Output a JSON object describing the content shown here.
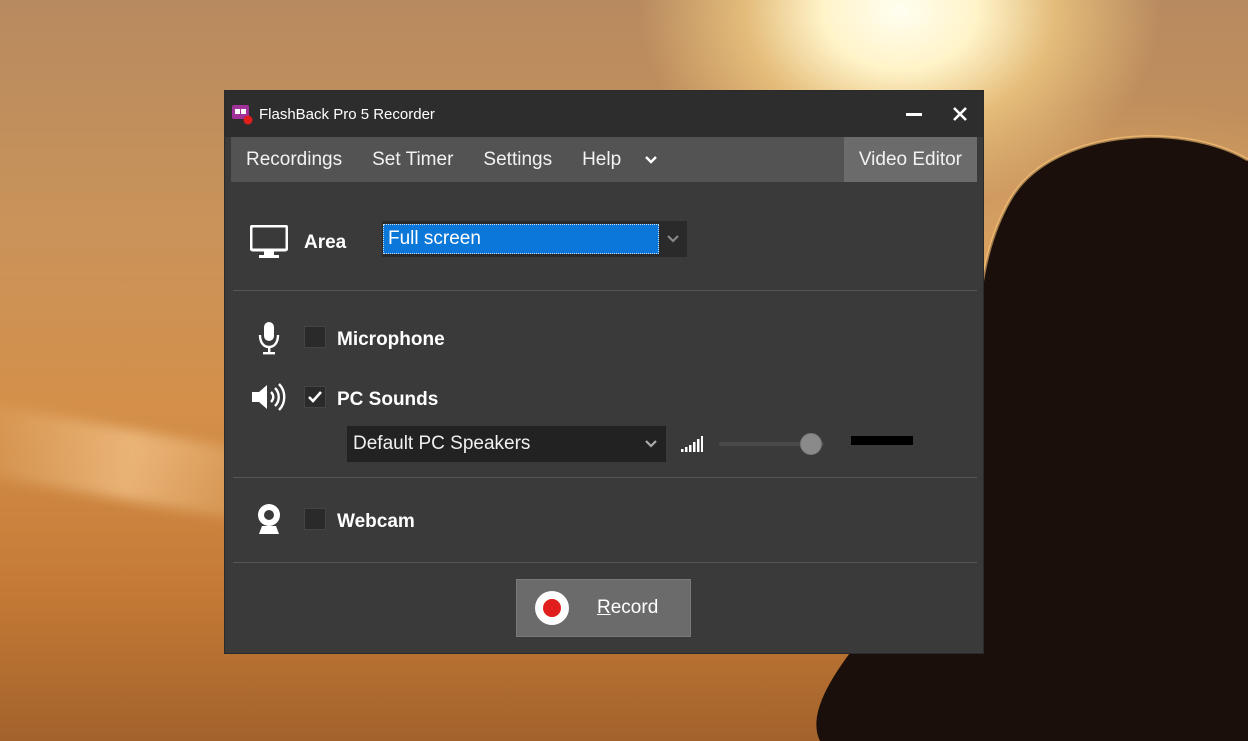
{
  "window": {
    "title": "FlashBack Pro 5 Recorder",
    "minimize_icon": "minimize-icon",
    "close_icon": "close-icon"
  },
  "menu": {
    "items": [
      "Recordings",
      "Set Timer",
      "Settings",
      "Help"
    ],
    "more_icon": "chevron-down-icon",
    "video_editor": "Video Editor"
  },
  "area": {
    "icon": "monitor-icon",
    "label": "Area",
    "selected": "Full screen"
  },
  "microphone": {
    "icon": "microphone-icon",
    "label": "Microphone",
    "checked": false
  },
  "pc_sounds": {
    "icon": "speaker-icon",
    "label": "PC Sounds",
    "checked": true,
    "device": "Default PC Speakers",
    "volume_icon": "volume-bars-icon",
    "volume_level": 0.88
  },
  "webcam": {
    "icon": "webcam-icon",
    "label": "Webcam",
    "checked": false
  },
  "record": {
    "label_underlined": "R",
    "label_rest": "ecord"
  },
  "colors": {
    "window_bg": "#3a3a3a",
    "titlebar_bg": "#2d2d2d",
    "menubar_bg": "#535353",
    "selection_blue": "#0b77d9",
    "record_red": "#e01e1e"
  }
}
